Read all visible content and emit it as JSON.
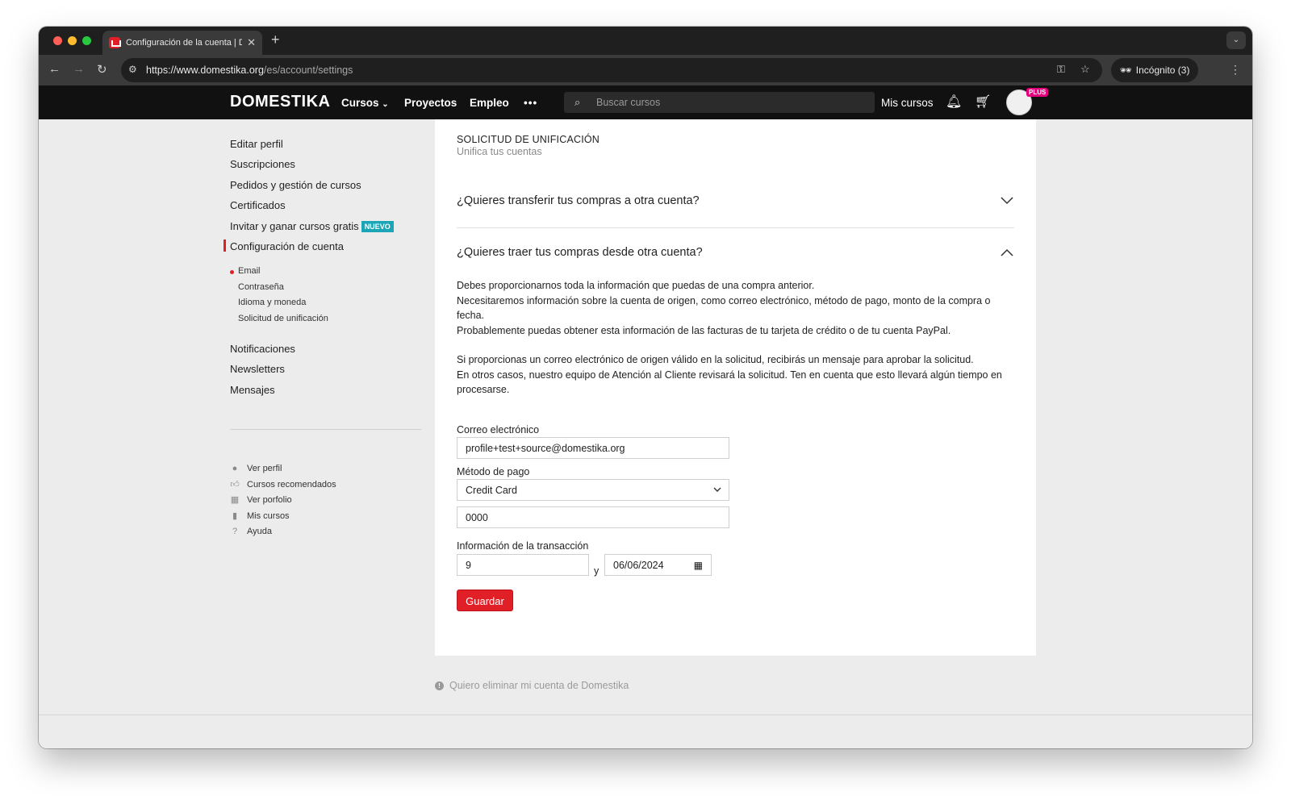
{
  "browser": {
    "tab_title": "Configuración de la cuenta | D",
    "url_host": "https://www.domestika.org",
    "url_path": "/es/account/settings",
    "incognito_label": "Incógnito (3)"
  },
  "header": {
    "logo": "DOMESTIKA",
    "nav": [
      "Cursos",
      "Proyectos",
      "Empleo",
      "•••"
    ],
    "search_placeholder": "Buscar cursos",
    "my_courses": "Mis cursos",
    "badge": "PLUS"
  },
  "sidebar": {
    "items": [
      {
        "label": "Editar perfil"
      },
      {
        "label": "Suscripciones"
      },
      {
        "label": "Pedidos y gestión de cursos"
      },
      {
        "label": "Certificados"
      },
      {
        "label": "Invitar y ganar cursos gratis",
        "badge": "NUEVO"
      },
      {
        "label": "Configuración de cuenta",
        "active": true
      }
    ],
    "subitems": [
      "Email",
      "Contraseña",
      "Idioma y moneda",
      "Solicitud de unificación"
    ],
    "items2": [
      "Notificaciones",
      "Newsletters",
      "Mensajes"
    ],
    "links": [
      {
        "label": "Ver perfil",
        "icon": "user-icon"
      },
      {
        "label": "Cursos recomendados",
        "icon": "thumbs-up-icon"
      },
      {
        "label": "Ver porfolio",
        "icon": "grid-icon"
      },
      {
        "label": "Mis cursos",
        "icon": "bookmark-icon"
      },
      {
        "label": "Ayuda",
        "icon": "help-icon"
      }
    ]
  },
  "main": {
    "section_title": "SOLICITUD DE UNIFICACIÓN",
    "section_subtitle": "Unifica tus cuentas",
    "q1": "¿Quieres transferir tus compras a otra cuenta?",
    "q2": "¿Quieres traer tus compras desde otra cuenta?",
    "p1": [
      "Debes proporcionarnos toda la información que puedas de una compra anterior.",
      "Necesitaremos información sobre la cuenta de origen, como correo electrónico, método de pago, monto de la compra o fecha.",
      "Probablemente puedas obtener esta información de las facturas de tu tarjeta de crédito o de tu cuenta PayPal."
    ],
    "p2": [
      "Si proporcionas un correo electrónico de origen válido en la solicitud, recibirás un mensaje para aprobar la solicitud.",
      "En otros casos, nuestro equipo de Atención al Cliente revisará la solicitud. Ten en cuenta que esto llevará algún tiempo en procesarse."
    ],
    "form": {
      "email_label": "Correo electrónico",
      "email_value": "profile+test+source@domestika.org",
      "payment_label": "Método de pago",
      "payment_value": "Credit Card",
      "card_value": "0000",
      "tx_label": "Información de la transacción",
      "amount_value": "9",
      "separator": "y",
      "date_value": "06/06/2024",
      "save_label": "Guardar"
    }
  },
  "footer": {
    "delete_account": "Quiero eliminar mi cuenta de Domestika"
  }
}
